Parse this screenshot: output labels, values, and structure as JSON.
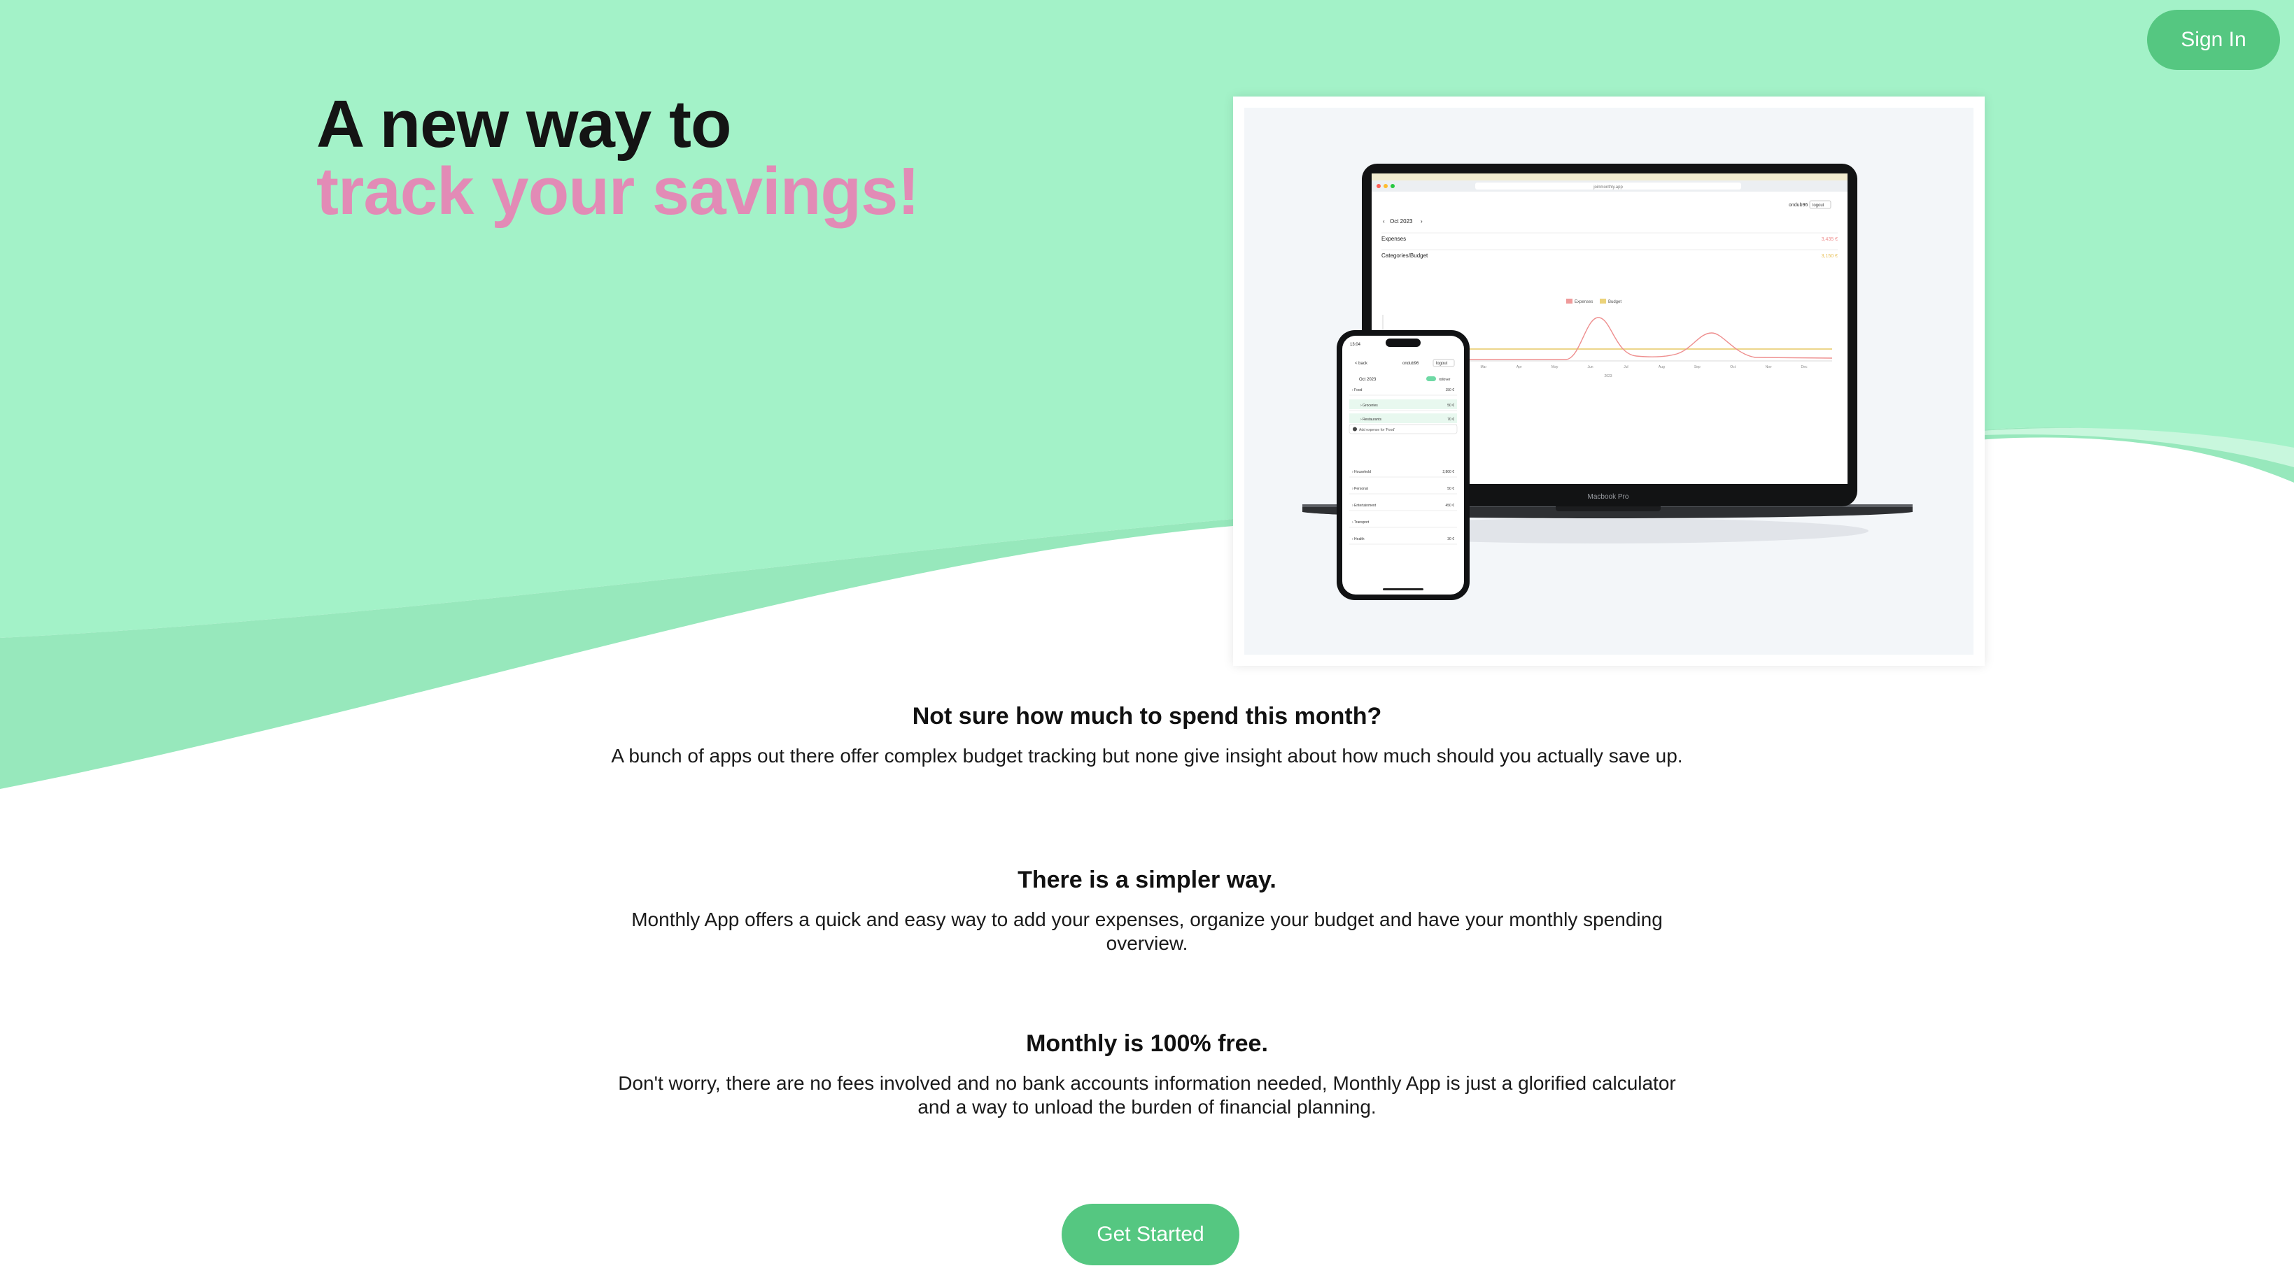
{
  "header": {
    "signin_label": "Sign In"
  },
  "hero": {
    "title_line1": "A new way to",
    "title_line2": "track your savings!"
  },
  "showcase": {
    "laptop": {
      "label": "Macbook Pro",
      "month": "Oct 2023",
      "rows": [
        {
          "label": "Expenses",
          "value": "3,435 €"
        },
        {
          "label": "Categories/Budget",
          "value": "3,150 €"
        }
      ],
      "legend": [
        "Expenses",
        "Budget"
      ],
      "months": [
        "Jan",
        "Feb",
        "Mar",
        "Apr",
        "May",
        "Jun",
        "Jul",
        "Aug",
        "Sep",
        "Oct",
        "Nov",
        "Dec"
      ],
      "year": "2023",
      "user": "ondub96",
      "logout": "logout",
      "url": "joinmonthly.app"
    },
    "phone": {
      "time": "13:04",
      "back": "< back",
      "user": "ondub96",
      "logout": "logout",
      "month": "Oct 2023",
      "rollover": "rollover",
      "add_label": "Add expense for 'Food'",
      "categories": [
        {
          "name": "Food",
          "value": "150 €"
        },
        {
          "name": "Groceries",
          "value": "50 €"
        },
        {
          "name": "Restaurants",
          "value": "70 €"
        },
        {
          "name": "Household",
          "value": "2,800 €"
        },
        {
          "name": "Personal",
          "value": "50 €"
        },
        {
          "name": "Entertainment",
          "value": "450 €"
        },
        {
          "name": "Transport",
          "value": ""
        },
        {
          "name": "Health",
          "value": "30 €"
        }
      ]
    }
  },
  "sections": [
    {
      "heading": "Not sure how much to spend this month?",
      "body": "A bunch of apps out there offer complex budget tracking but none give insight about how much should you actually save up."
    },
    {
      "heading": "There is a simpler way.",
      "body": "Monthly App offers a quick and easy way to add your expenses, organize your budget and have your monthly spending overview."
    },
    {
      "heading": "Monthly is 100% free.",
      "body": "Don't worry, there are no fees involved and no bank accounts information needed, Monthly App is just a glorified calculator and a way to unload the burden of financial planning."
    }
  ],
  "cta": {
    "label": "Get Started"
  },
  "colors": {
    "hero_bg": "#a3f2c8",
    "hero_band": "#97e8bc",
    "button_green": "#55c781",
    "accent_pink": "#e28bb6"
  }
}
